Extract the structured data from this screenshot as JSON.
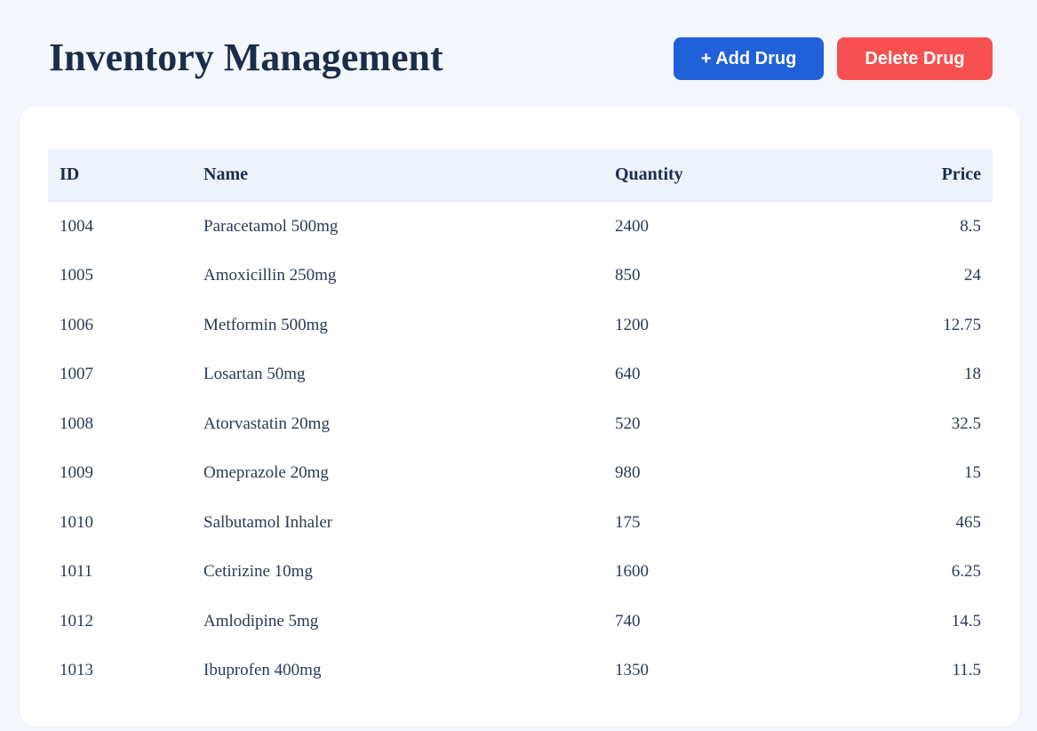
{
  "header": {
    "title": "Inventory Management",
    "add_button_label": "+ Add Drug",
    "delete_button_label": "Delete Drug"
  },
  "colors": {
    "add_button": "#2160d9",
    "delete_button": "#f75050",
    "title": "#1b2d4a",
    "background": "#f4f7fc"
  },
  "table": {
    "columns": [
      "ID",
      "Name",
      "Quantity",
      "Price"
    ],
    "rows": [
      {
        "id": "1004",
        "name": "Paracetamol 500mg",
        "quantity": "2400",
        "price": "8.5"
      },
      {
        "id": "1005",
        "name": "Amoxicillin 250mg",
        "quantity": "850",
        "price": "24"
      },
      {
        "id": "1006",
        "name": "Metformin 500mg",
        "quantity": "1200",
        "price": "12.75"
      },
      {
        "id": "1007",
        "name": "Losartan 50mg",
        "quantity": "640",
        "price": "18"
      },
      {
        "id": "1008",
        "name": "Atorvastatin 20mg",
        "quantity": "520",
        "price": "32.5"
      },
      {
        "id": "1009",
        "name": "Omeprazole 20mg",
        "quantity": "980",
        "price": "15"
      },
      {
        "id": "1010",
        "name": "Salbutamol Inhaler",
        "quantity": "175",
        "price": "465"
      },
      {
        "id": "1011",
        "name": "Cetirizine 10mg",
        "quantity": "1600",
        "price": "6.25"
      },
      {
        "id": "1012",
        "name": "Amlodipine 5mg",
        "quantity": "740",
        "price": "14.5"
      },
      {
        "id": "1013",
        "name": "Ibuprofen 400mg",
        "quantity": "1350",
        "price": "11.5"
      }
    ]
  }
}
